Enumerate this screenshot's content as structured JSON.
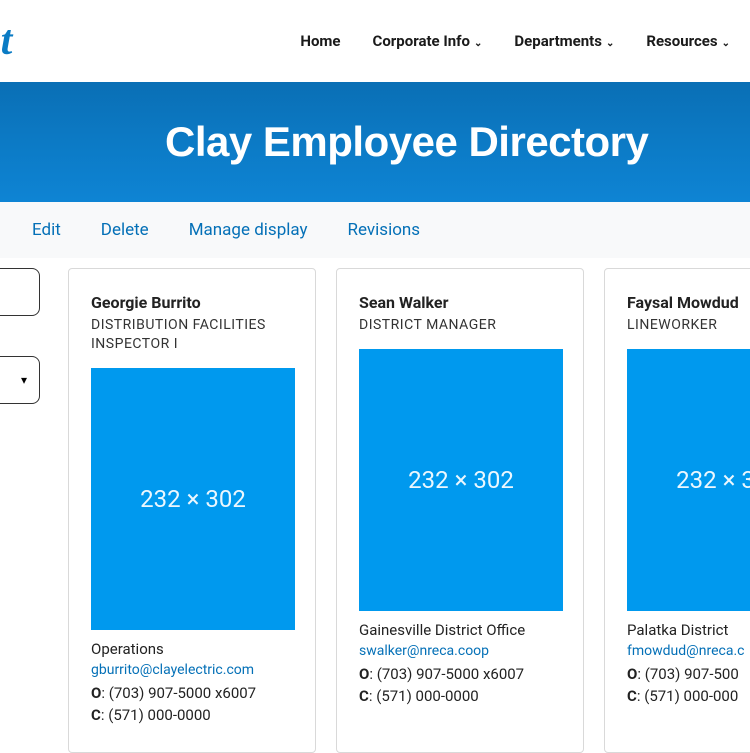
{
  "logo_fragment": "et",
  "nav": {
    "home": "Home",
    "corporate_info": "Corporate Info",
    "departments": "Departments",
    "resources": "Resources"
  },
  "hero": {
    "title": "Clay Employee Directory"
  },
  "tabs": {
    "edit": "Edit",
    "delete": "Delete",
    "manage_display": "Manage display",
    "revisions": "Revisions"
  },
  "photo_placeholder": "232 × 302",
  "employees": [
    {
      "name": "Georgie Burrito",
      "title": "DISTRIBUTION FACILITIES INSPECTOR I",
      "dept": "Operations",
      "email": "gburrito@clayelectric.com",
      "office": "(703) 907-5000 x6007",
      "cell": "(571) 000-0000"
    },
    {
      "name": "Sean Walker",
      "title": "DISTRICT MANAGER",
      "dept": "Gainesville District Office",
      "email": "swalker@nreca.coop",
      "office": "(703) 907-5000 x6007",
      "cell": "(571) 000-0000"
    },
    {
      "name": "Faysal Mowdud",
      "title": "LINEWORKER",
      "dept": "Palatka District",
      "email": "fmowdud@nreca.c",
      "office": "(703) 907-500",
      "cell": "(571) 000-000"
    }
  ],
  "labels": {
    "office": "O",
    "cell": "C"
  }
}
